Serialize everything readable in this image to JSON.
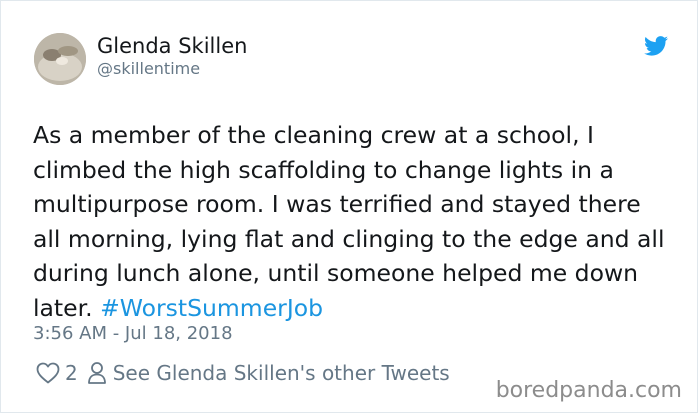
{
  "author": {
    "display_name": "Glenda Skillen",
    "handle": "@skillentime"
  },
  "tweet": {
    "text_before_hashtag": "As a member of the cleaning crew at a school, I climbed the high scaffolding to change lights in a multipurpose room. I was terrified and stayed there all morning, lying flat and clinging to the edge and all during lunch alone, until someone helped me down later.",
    "hashtag": "#WorstSummerJob",
    "timestamp": "3:56 AM - Jul 18, 2018"
  },
  "actions": {
    "like_count": "2",
    "other_tweets_label": "See Glenda Skillen's other Tweets"
  },
  "icons": {
    "heart": "heart-icon",
    "person": "person-icon",
    "bird": "twitter-bird-icon"
  },
  "colors": {
    "twitter_blue": "#1da1f2",
    "hashtag": "#1b95e0",
    "secondary_text": "#657786",
    "primary_text": "#14171a"
  },
  "watermark": "boredpanda.com"
}
